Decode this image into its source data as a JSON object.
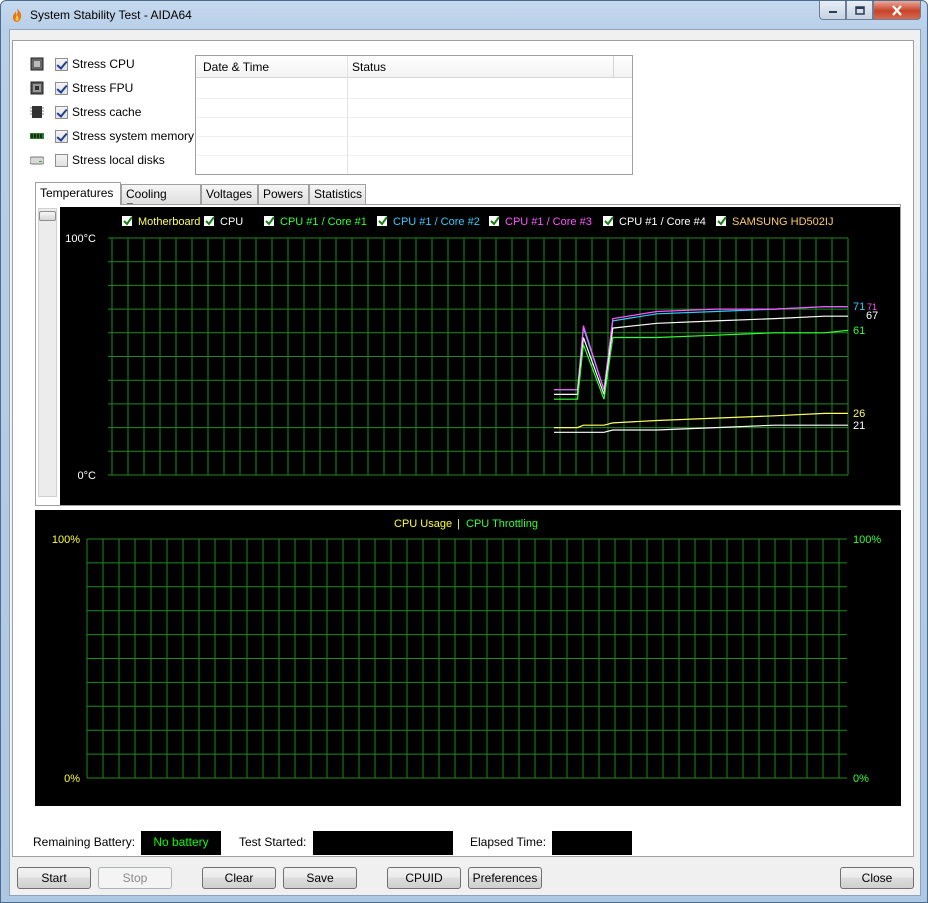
{
  "window": {
    "title": "System Stability Test - AIDA64"
  },
  "stress_options": [
    {
      "label": "Stress CPU",
      "checked": true,
      "icon": "cpu-icon"
    },
    {
      "label": "Stress FPU",
      "checked": true,
      "icon": "fpu-icon"
    },
    {
      "label": "Stress cache",
      "checked": true,
      "icon": "cache-icon"
    },
    {
      "label": "Stress system memory",
      "checked": true,
      "icon": "memory-icon"
    },
    {
      "label": "Stress local disks",
      "checked": false,
      "icon": "disk-icon"
    }
  ],
  "log": {
    "col_datetime": "Date & Time",
    "col_status": "Status"
  },
  "tabs": [
    "Temperatures",
    "Cooling Fans",
    "Voltages",
    "Powers",
    "Statistics"
  ],
  "temp_chart": {
    "top_label": "100°C",
    "bottom_label": "0°C",
    "legend": [
      {
        "label": "Motherboard",
        "color": "#ffff66"
      },
      {
        "label": "CPU",
        "color": "#ffffff"
      },
      {
        "label": "CPU #1 / Core #1",
        "color": "#33ff33"
      },
      {
        "label": "CPU #1 / Core #2",
        "color": "#33ccff"
      },
      {
        "label": "CPU #1 / Core #3",
        "color": "#ff55ff"
      },
      {
        "label": "CPU #1 / Core #4",
        "color": "#ffffff"
      },
      {
        "label": "SAMSUNG HD502IJ",
        "color": "#ffcc66"
      }
    ],
    "end_values": [
      {
        "text": "71",
        "color": "#33ccff"
      },
      {
        "text": "71",
        "color": "#ff55ff"
      },
      {
        "text": "67",
        "color": "#ffffff"
      },
      {
        "text": "61",
        "color": "#33ff33"
      },
      {
        "text": "26",
        "color": "#ffff66"
      },
      {
        "text": "21",
        "color": "#ffffff"
      }
    ]
  },
  "usage_chart": {
    "legend_usage": "CPU Usage",
    "legend_sep": "|",
    "legend_throttle": "CPU Throttling",
    "left_top": "100%",
    "left_bottom": "0%",
    "right_top": "100%",
    "right_bottom": "0%",
    "usage_color": "#ffff33",
    "throttle_color": "#33ff33"
  },
  "chart_data": [
    {
      "type": "line",
      "ylim": [
        0,
        100
      ],
      "series": [
        {
          "name": "CPU #1 / Core #2",
          "values": [
            36,
            36,
            62,
            36,
            65,
            68,
            69,
            70,
            71,
            71
          ]
        },
        {
          "name": "CPU #1 / Core #3",
          "values": [
            36,
            36,
            63,
            36,
            66,
            69,
            70,
            70,
            71,
            71
          ]
        },
        {
          "name": "CPU #1 / Core #4",
          "values": [
            34,
            34,
            58,
            34,
            62,
            64,
            65,
            66,
            67,
            67
          ]
        },
        {
          "name": "CPU #1 / Core #1",
          "values": [
            32,
            32,
            55,
            32,
            58,
            58,
            59,
            60,
            60,
            61
          ]
        },
        {
          "name": "Motherboard",
          "values": [
            20,
            20,
            21,
            21,
            22,
            23,
            24,
            25,
            26,
            26
          ]
        },
        {
          "name": "CPU",
          "values": [
            18,
            18,
            18,
            18,
            19,
            19,
            20,
            21,
            21,
            21
          ]
        }
      ]
    },
    {
      "type": "line",
      "ylim": [
        0,
        100
      ],
      "series": []
    }
  ],
  "status": {
    "battery_label": "Remaining Battery:",
    "battery_value": "No battery",
    "test_started_label": "Test Started:",
    "test_started_value": "",
    "elapsed_label": "Elapsed Time:",
    "elapsed_value": ""
  },
  "buttons": {
    "start": "Start",
    "stop": "Stop",
    "clear": "Clear",
    "save": "Save",
    "cpuid": "CPUID",
    "preferences": "Preferences",
    "close": "Close"
  }
}
